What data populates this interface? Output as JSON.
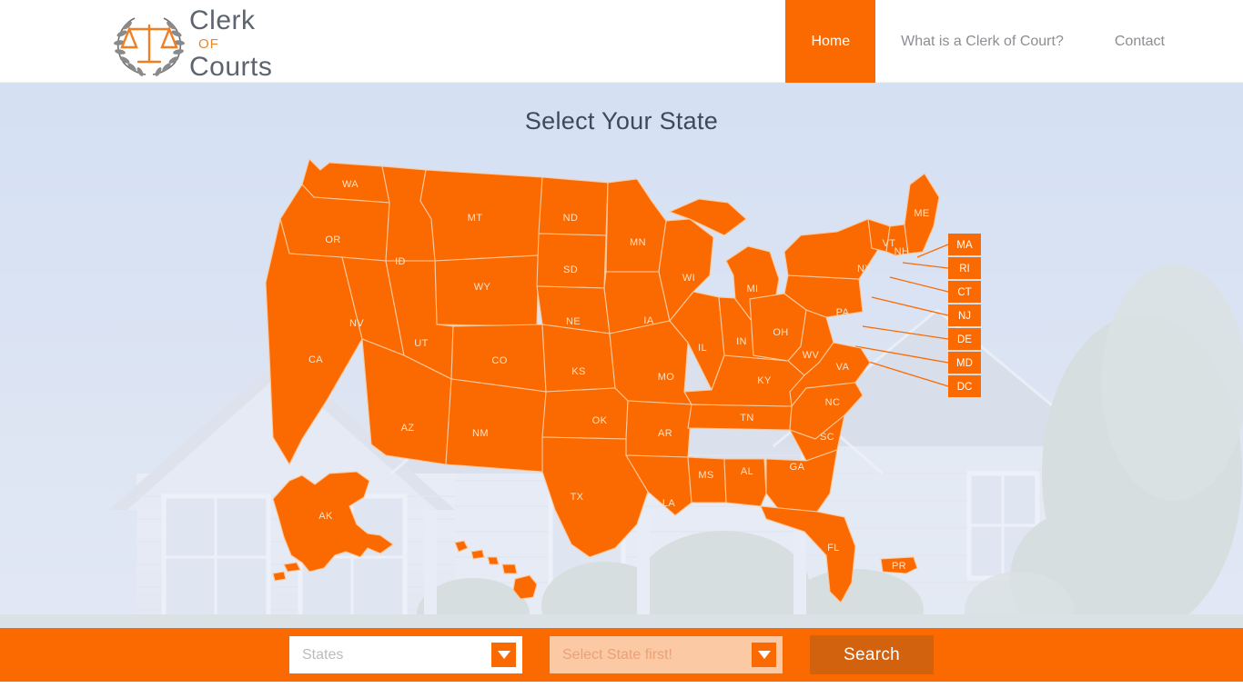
{
  "site": {
    "logo": {
      "line1": "Clerk",
      "line2": "OF",
      "line3": "Courts",
      "icon": "scales-of-justice-laurel-icon"
    }
  },
  "nav": {
    "items": [
      {
        "label": "Home",
        "active": true
      },
      {
        "label": "What is a Clerk of Court?",
        "active": false
      },
      {
        "label": "Contact",
        "active": false
      }
    ]
  },
  "hero": {
    "title": "Select Your State",
    "background": "suburban-house-photo"
  },
  "colors": {
    "brand_orange": "#fb6a00",
    "search_button": "#d2620d",
    "map_fill": "#fb6a00",
    "map_stroke": "#fcc89c",
    "state_label": "#ffe3c9",
    "heading": "#3e4a5c",
    "nav_inactive": "#8b8e93",
    "disabled_field": "#fbc9a4"
  },
  "search": {
    "state_select": {
      "value": "States",
      "placeholder": "States",
      "disabled": false
    },
    "county_select": {
      "value": "Select State first!",
      "placeholder": "Select State first!",
      "disabled": true
    },
    "button_label": "Search"
  },
  "map": {
    "title": "United States clickable state map",
    "state_labels": [
      "WA",
      "OR",
      "CA",
      "NV",
      "ID",
      "MT",
      "WY",
      "UT",
      "AZ",
      "CO",
      "NM",
      "ND",
      "SD",
      "NE",
      "KS",
      "OK",
      "TX",
      "MN",
      "IA",
      "MO",
      "AR",
      "LA",
      "WI",
      "IL",
      "MS",
      "AL",
      "TN",
      "KY",
      "IN",
      "MI",
      "OH",
      "WV",
      "VA",
      "NC",
      "SC",
      "GA",
      "FL",
      "PA",
      "NY",
      "VT",
      "NH",
      "ME",
      "AK"
    ],
    "callouts": [
      "MA",
      "RI",
      "CT",
      "NJ",
      "DE",
      "MD",
      "DC"
    ],
    "inset_labels": [
      "AK",
      "PR"
    ]
  }
}
